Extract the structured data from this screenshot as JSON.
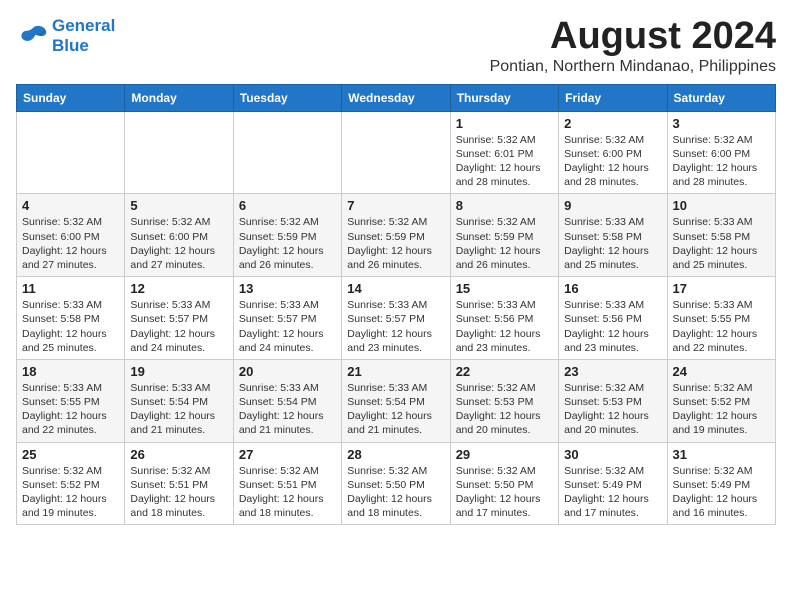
{
  "logo": {
    "line1": "General",
    "line2": "Blue"
  },
  "title": "August 2024",
  "location": "Pontian, Northern Mindanao, Philippines",
  "days_header": [
    "Sunday",
    "Monday",
    "Tuesday",
    "Wednesday",
    "Thursday",
    "Friday",
    "Saturday"
  ],
  "weeks": [
    [
      {
        "day": "",
        "info": ""
      },
      {
        "day": "",
        "info": ""
      },
      {
        "day": "",
        "info": ""
      },
      {
        "day": "",
        "info": ""
      },
      {
        "day": "1",
        "sunrise": "5:32 AM",
        "sunset": "6:01 PM",
        "daylight": "12 hours and 28 minutes."
      },
      {
        "day": "2",
        "sunrise": "5:32 AM",
        "sunset": "6:00 PM",
        "daylight": "12 hours and 28 minutes."
      },
      {
        "day": "3",
        "sunrise": "5:32 AM",
        "sunset": "6:00 PM",
        "daylight": "12 hours and 28 minutes."
      }
    ],
    [
      {
        "day": "4",
        "sunrise": "5:32 AM",
        "sunset": "6:00 PM",
        "daylight": "12 hours and 27 minutes."
      },
      {
        "day": "5",
        "sunrise": "5:32 AM",
        "sunset": "6:00 PM",
        "daylight": "12 hours and 27 minutes."
      },
      {
        "day": "6",
        "sunrise": "5:32 AM",
        "sunset": "5:59 PM",
        "daylight": "12 hours and 26 minutes."
      },
      {
        "day": "7",
        "sunrise": "5:32 AM",
        "sunset": "5:59 PM",
        "daylight": "12 hours and 26 minutes."
      },
      {
        "day": "8",
        "sunrise": "5:32 AM",
        "sunset": "5:59 PM",
        "daylight": "12 hours and 26 minutes."
      },
      {
        "day": "9",
        "sunrise": "5:33 AM",
        "sunset": "5:58 PM",
        "daylight": "12 hours and 25 minutes."
      },
      {
        "day": "10",
        "sunrise": "5:33 AM",
        "sunset": "5:58 PM",
        "daylight": "12 hours and 25 minutes."
      }
    ],
    [
      {
        "day": "11",
        "sunrise": "5:33 AM",
        "sunset": "5:58 PM",
        "daylight": "12 hours and 25 minutes."
      },
      {
        "day": "12",
        "sunrise": "5:33 AM",
        "sunset": "5:57 PM",
        "daylight": "12 hours and 24 minutes."
      },
      {
        "day": "13",
        "sunrise": "5:33 AM",
        "sunset": "5:57 PM",
        "daylight": "12 hours and 24 minutes."
      },
      {
        "day": "14",
        "sunrise": "5:33 AM",
        "sunset": "5:57 PM",
        "daylight": "12 hours and 23 minutes."
      },
      {
        "day": "15",
        "sunrise": "5:33 AM",
        "sunset": "5:56 PM",
        "daylight": "12 hours and 23 minutes."
      },
      {
        "day": "16",
        "sunrise": "5:33 AM",
        "sunset": "5:56 PM",
        "daylight": "12 hours and 23 minutes."
      },
      {
        "day": "17",
        "sunrise": "5:33 AM",
        "sunset": "5:55 PM",
        "daylight": "12 hours and 22 minutes."
      }
    ],
    [
      {
        "day": "18",
        "sunrise": "5:33 AM",
        "sunset": "5:55 PM",
        "daylight": "12 hours and 22 minutes."
      },
      {
        "day": "19",
        "sunrise": "5:33 AM",
        "sunset": "5:54 PM",
        "daylight": "12 hours and 21 minutes."
      },
      {
        "day": "20",
        "sunrise": "5:33 AM",
        "sunset": "5:54 PM",
        "daylight": "12 hours and 21 minutes."
      },
      {
        "day": "21",
        "sunrise": "5:33 AM",
        "sunset": "5:54 PM",
        "daylight": "12 hours and 21 minutes."
      },
      {
        "day": "22",
        "sunrise": "5:32 AM",
        "sunset": "5:53 PM",
        "daylight": "12 hours and 20 minutes."
      },
      {
        "day": "23",
        "sunrise": "5:32 AM",
        "sunset": "5:53 PM",
        "daylight": "12 hours and 20 minutes."
      },
      {
        "day": "24",
        "sunrise": "5:32 AM",
        "sunset": "5:52 PM",
        "daylight": "12 hours and 19 minutes."
      }
    ],
    [
      {
        "day": "25",
        "sunrise": "5:32 AM",
        "sunset": "5:52 PM",
        "daylight": "12 hours and 19 minutes."
      },
      {
        "day": "26",
        "sunrise": "5:32 AM",
        "sunset": "5:51 PM",
        "daylight": "12 hours and 18 minutes."
      },
      {
        "day": "27",
        "sunrise": "5:32 AM",
        "sunset": "5:51 PM",
        "daylight": "12 hours and 18 minutes."
      },
      {
        "day": "28",
        "sunrise": "5:32 AM",
        "sunset": "5:50 PM",
        "daylight": "12 hours and 18 minutes."
      },
      {
        "day": "29",
        "sunrise": "5:32 AM",
        "sunset": "5:50 PM",
        "daylight": "12 hours and 17 minutes."
      },
      {
        "day": "30",
        "sunrise": "5:32 AM",
        "sunset": "5:49 PM",
        "daylight": "12 hours and 17 minutes."
      },
      {
        "day": "31",
        "sunrise": "5:32 AM",
        "sunset": "5:49 PM",
        "daylight": "12 hours and 16 minutes."
      }
    ]
  ],
  "labels": {
    "sunrise_label": "Sunrise:",
    "sunset_label": "Sunset:",
    "daylight_label": "Daylight: "
  }
}
